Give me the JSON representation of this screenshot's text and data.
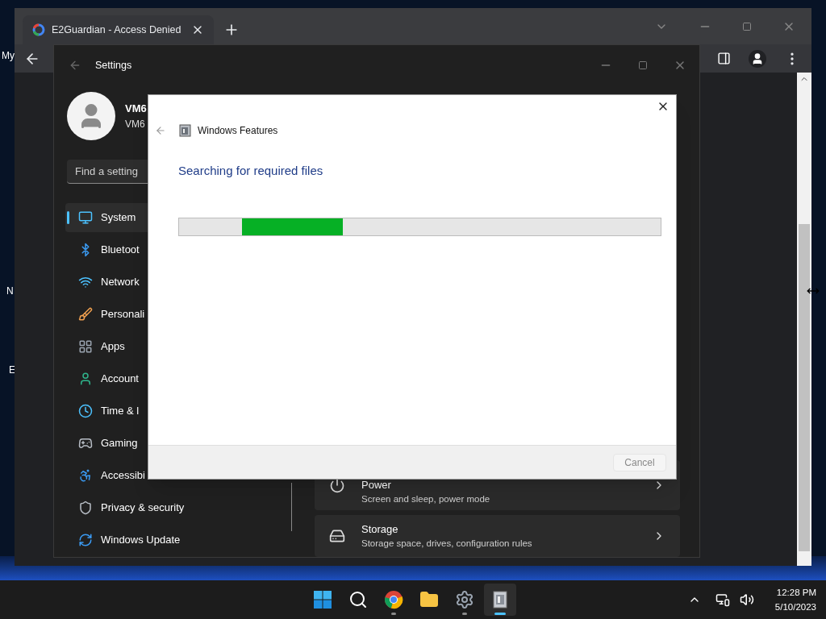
{
  "desktop_icons": [
    {
      "label": "My"
    },
    {
      "label": "N"
    },
    {
      "label": "E"
    }
  ],
  "browser": {
    "tab": {
      "title": "E2Guardian - Access Denied"
    }
  },
  "settings": {
    "title": "Settings",
    "user": {
      "name": "VM6",
      "account": "VM6"
    },
    "search": {
      "placeholder": "Find a setting"
    },
    "nav": [
      {
        "kind": "system",
        "label": "System",
        "selected": true
      },
      {
        "kind": "bluetooth",
        "label": "Bluetoot",
        "selected": false
      },
      {
        "kind": "network",
        "label": "Network",
        "selected": false
      },
      {
        "kind": "personalization",
        "label": "Personali",
        "selected": false
      },
      {
        "kind": "apps",
        "label": "Apps",
        "selected": false
      },
      {
        "kind": "accounts",
        "label": "Account",
        "selected": false
      },
      {
        "kind": "time",
        "label": "Time & l",
        "selected": false
      },
      {
        "kind": "gaming",
        "label": "Gaming",
        "selected": false
      },
      {
        "kind": "accessibility",
        "label": "Accessibi",
        "selected": false
      },
      {
        "kind": "privacy",
        "label": "Privacy & security",
        "selected": false
      },
      {
        "kind": "update",
        "label": "Windows Update",
        "selected": false
      }
    ],
    "cards": [
      {
        "kind": "power",
        "title": "Power",
        "subtitle": "Screen and sleep, power mode"
      },
      {
        "kind": "storage",
        "title": "Storage",
        "subtitle": "Storage space, drives, configuration rules"
      }
    ]
  },
  "dialog": {
    "title": "Windows Features",
    "heading": "Searching for required files",
    "progress": {
      "level": 0.21
    },
    "cancel": {
      "label": "Cancel",
      "disabled": true
    }
  },
  "taskbar": {
    "apps": [
      {
        "kind": "start",
        "running": false,
        "selected": false
      },
      {
        "kind": "search",
        "running": false,
        "selected": false
      },
      {
        "kind": "browser",
        "running": true,
        "selected": false
      },
      {
        "kind": "files",
        "running": false,
        "selected": false
      },
      {
        "kind": "settings",
        "running": true,
        "selected": false
      },
      {
        "kind": "features",
        "running": true,
        "selected": true
      }
    ],
    "clock": {
      "time": "12:28 PM",
      "date": "5/10/2023"
    }
  }
}
